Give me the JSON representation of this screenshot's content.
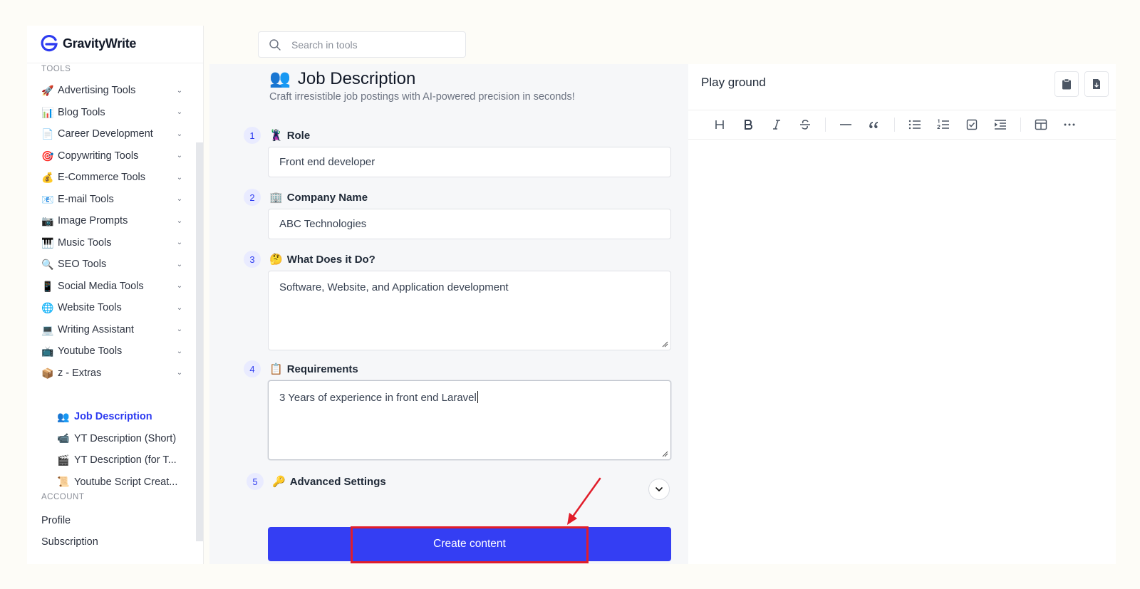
{
  "brand": {
    "name": "GravityWrite",
    "color": "#2d3bf0"
  },
  "search": {
    "placeholder": "Search in tools"
  },
  "sidebar": {
    "tools_heading": "TOOLS",
    "items": [
      {
        "label": "Advertising Tools",
        "icon": "🚀"
      },
      {
        "label": "Blog Tools",
        "icon": "📊"
      },
      {
        "label": "Career Development",
        "icon": "📄"
      },
      {
        "label": "Copywriting Tools",
        "icon": "🎯"
      },
      {
        "label": "E-Commerce Tools",
        "icon": "💰"
      },
      {
        "label": "E-mail Tools",
        "icon": "📧"
      },
      {
        "label": "Image Prompts",
        "icon": "📷"
      },
      {
        "label": "Music Tools",
        "icon": "🎹"
      },
      {
        "label": "SEO Tools",
        "icon": "🔍"
      },
      {
        "label": "Social Media Tools",
        "icon": "📱"
      },
      {
        "label": "Website Tools",
        "icon": "🌐"
      },
      {
        "label": "Writing Assistant",
        "icon": "💻"
      },
      {
        "label": "Youtube Tools",
        "icon": "📺"
      },
      {
        "label": "z - Extras",
        "icon": "📦"
      }
    ],
    "sub_items": [
      {
        "label": "Job Description",
        "icon": "👥",
        "active": true
      },
      {
        "label": "YT Description (Short)",
        "icon": "📹"
      },
      {
        "label": "YT Description (for T...",
        "icon": "🎬"
      },
      {
        "label": "Youtube Script Creat...",
        "icon": "📜"
      }
    ],
    "account_heading": "ACCOUNT",
    "account_items": [
      {
        "label": "Profile"
      },
      {
        "label": "Subscription"
      }
    ]
  },
  "tool": {
    "icon": "👥",
    "title": "Job Description",
    "description": "Craft irresistible job postings with AI-powered precision in seconds!"
  },
  "form": {
    "steps": [
      {
        "num": "1",
        "icon": "🦹",
        "label": "Role",
        "value": "Front end developer"
      },
      {
        "num": "2",
        "icon": "🏢",
        "label": "Company Name",
        "value": "ABC Technologies"
      },
      {
        "num": "3",
        "icon": "🤔",
        "label": "What Does it Do?",
        "value": "Software, Website, and Application development"
      },
      {
        "num": "4",
        "icon": "📋",
        "label": "Requirements",
        "value": "3 Years of experience in front end Laravel"
      },
      {
        "num": "5",
        "icon": "🔑",
        "label": "Advanced Settings"
      }
    ],
    "submit_label": "Create content",
    "submit_color": "#343ef3"
  },
  "playground": {
    "title": "Play ground",
    "actions": [
      "clipboard-icon",
      "document-export-icon"
    ],
    "toolbar": [
      "heading-icon",
      "bold-icon",
      "italic-icon",
      "strikethrough-icon",
      "horizontal-rule-icon",
      "blockquote-icon",
      "bullet-list-icon",
      "ordered-list-icon",
      "task-list-icon",
      "indent-icon",
      "table-icon",
      "more-icon"
    ]
  },
  "annotation": {
    "color": "#e11d2a"
  }
}
